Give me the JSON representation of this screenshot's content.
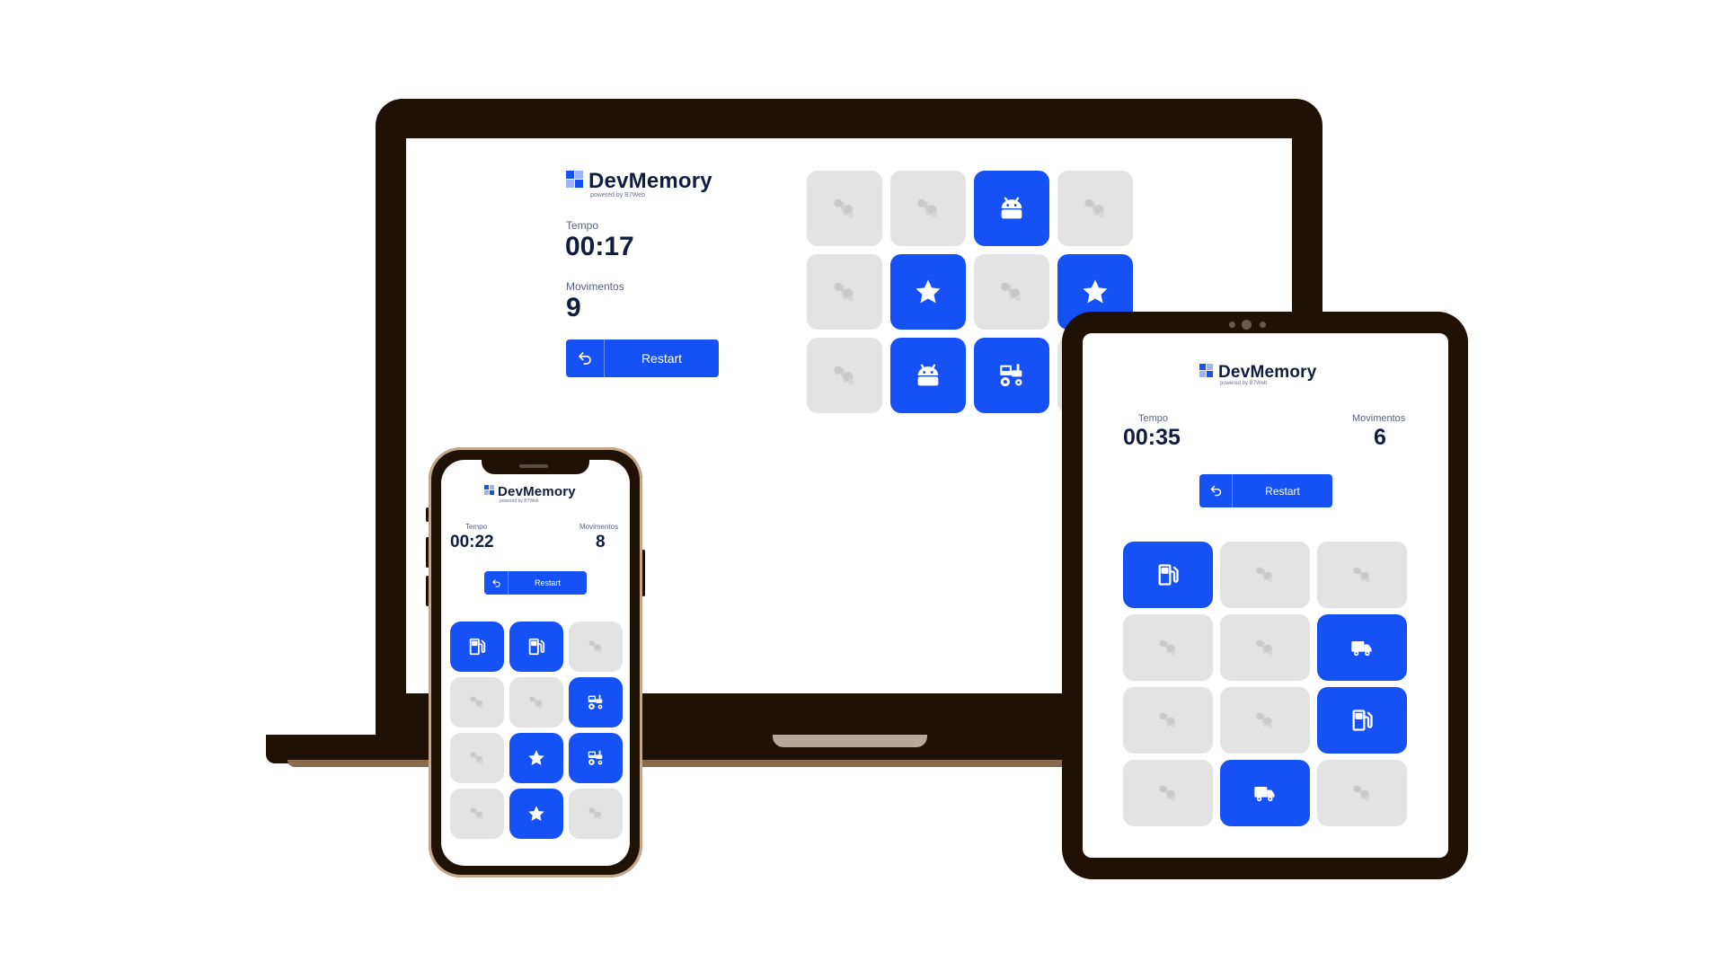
{
  "app": {
    "name": "DevMemory",
    "tagline": "powered by B7Web",
    "colors": {
      "primary": "#1551f5",
      "card_hidden": "#e3e3e3",
      "text": "#101c40"
    }
  },
  "labels": {
    "time": "Tempo",
    "moves": "Movimentos",
    "restart": "Restart"
  },
  "laptop": {
    "time": "00:17",
    "moves": "9",
    "cards": [
      [
        "hidden",
        "hidden",
        "android",
        "hidden"
      ],
      [
        "hidden",
        "star",
        "hidden",
        "star"
      ],
      [
        "hidden",
        "android",
        "tractor",
        "hidden"
      ]
    ]
  },
  "tablet": {
    "time": "00:35",
    "moves": "6",
    "cards": [
      [
        "fuel",
        "hidden",
        "hidden"
      ],
      [
        "hidden",
        "hidden",
        "truck"
      ],
      [
        "hidden",
        "hidden",
        "fuel"
      ],
      [
        "hidden",
        "truck",
        "hidden"
      ]
    ]
  },
  "phone": {
    "time": "00:22",
    "moves": "8",
    "cards": [
      [
        "fuel",
        "fuel",
        "hidden"
      ],
      [
        "hidden",
        "hidden",
        "tractor"
      ],
      [
        "hidden",
        "star",
        "tractor"
      ],
      [
        "hidden",
        "star",
        "hidden"
      ]
    ]
  }
}
